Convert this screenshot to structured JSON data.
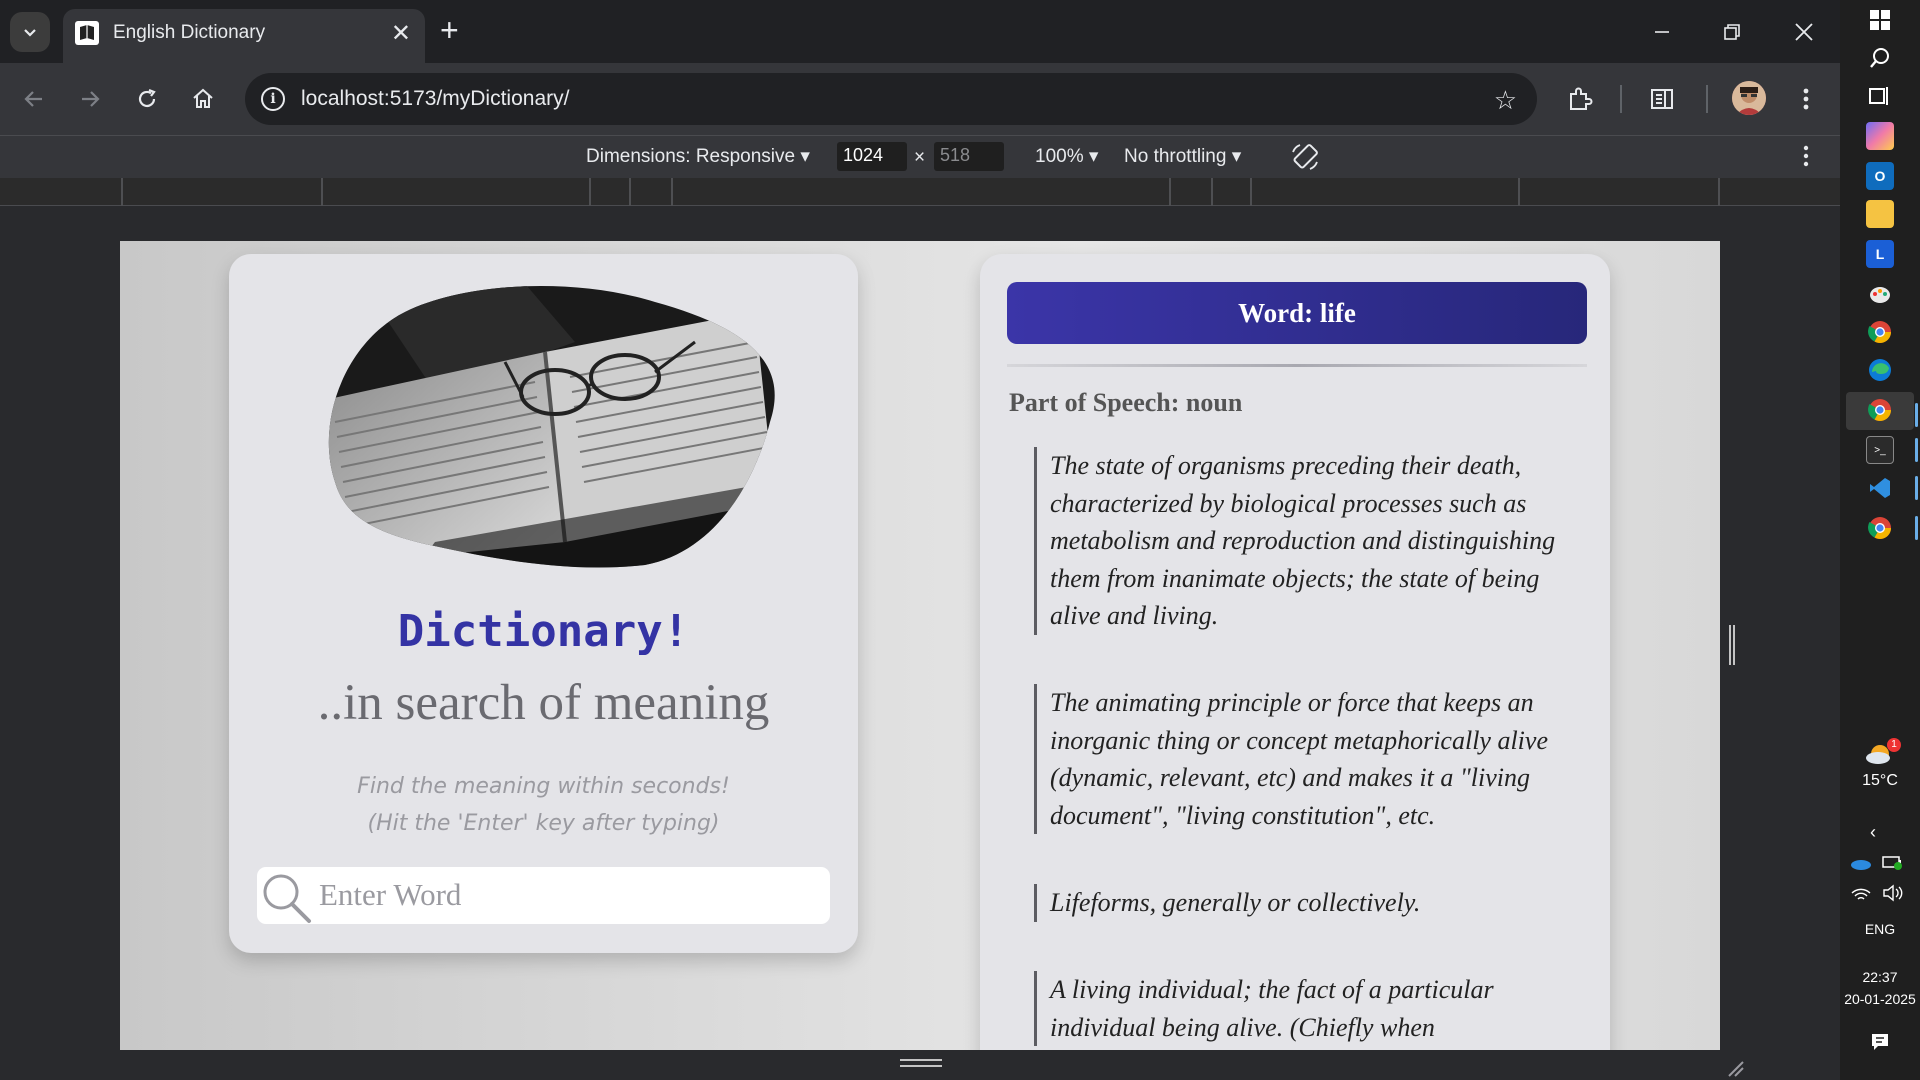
{
  "browser": {
    "tab": {
      "title": "English Dictionary"
    },
    "address": {
      "host": "localhost",
      "rest": ":5173/myDictionary/"
    }
  },
  "device_toolbar": {
    "dimensions_label": "Dimensions: Responsive",
    "width": "1024",
    "times": "×",
    "height": "518",
    "zoom": "100%",
    "throttling": "No throttling"
  },
  "search_panel": {
    "title": "Dictionary!",
    "subtitle": "..in search of meaning",
    "hint_line1": "Find the meaning within seconds!",
    "hint_line2": "(Hit the 'Enter' key after typing)",
    "placeholder": "Enter Word"
  },
  "result_panel": {
    "word_heading": "Word: life",
    "part_of_speech": "Part of Speech: noun",
    "definitions": [
      "The state of organisms preceding their death, characterized by biological processes such as metabolism and reproduction and distinguishing them from inanimate objects; the state of being alive and living.",
      "The animating principle or force that keeps an inorganic thing or concept metaphorically alive (dynamic, relevant, etc) and makes it a \"living document\", \"living constitution\", etc.",
      "Lifeforms, generally or collectively.",
      "A living individual; the fact of a particular individual being alive. (Chiefly when"
    ]
  },
  "taskbar": {
    "temperature": "15°C",
    "weather_badge": "1",
    "language": "ENG",
    "time": "22:37",
    "date": "20-01-2025"
  },
  "colors": {
    "accent": "#3433a4",
    "banner_start": "#3b35a8",
    "banner_end": "#27277a",
    "chrome_bg": "#202124",
    "toolbar_bg": "#35363a"
  }
}
